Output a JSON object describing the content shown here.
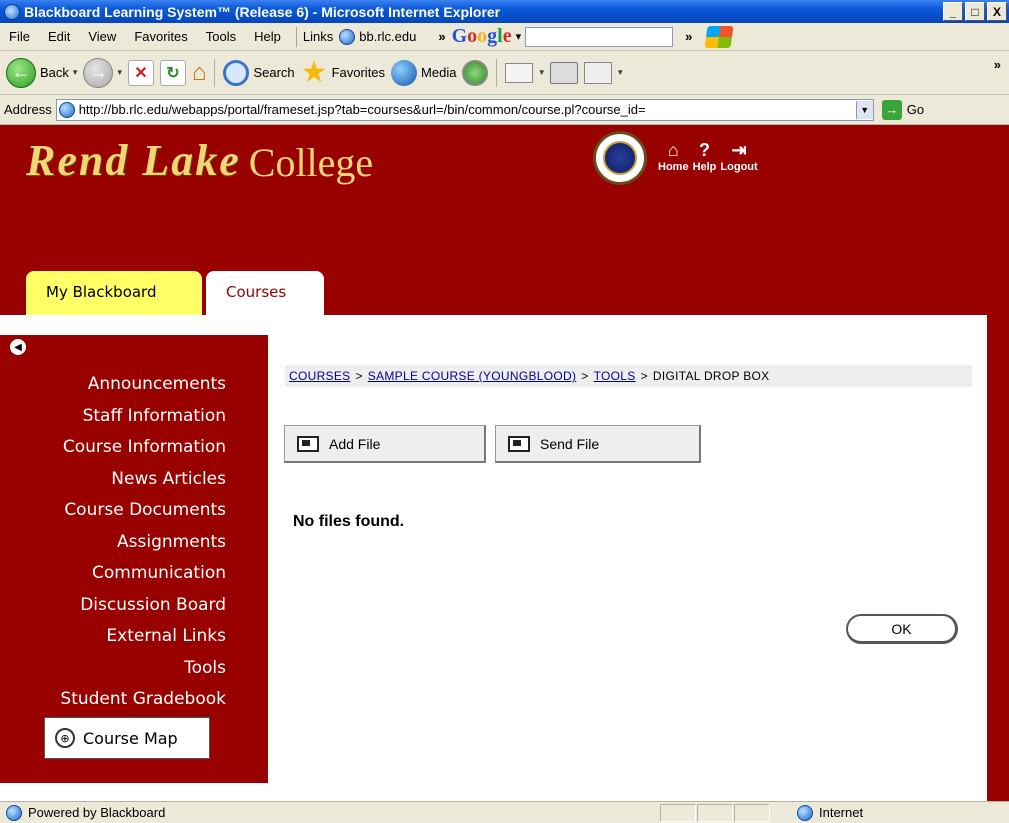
{
  "window": {
    "title": "Blackboard Learning System™ (Release 6) - Microsoft Internet Explorer",
    "min_label": "_",
    "max_label": "□",
    "close_label": "X"
  },
  "menubar": {
    "items": [
      "File",
      "Edit",
      "View",
      "Favorites",
      "Tools",
      "Help"
    ],
    "links_label": "Links",
    "link_bb": "bb.rlc.edu",
    "chevron": "»",
    "google_letters": [
      "G",
      "o",
      "o",
      "g",
      "l",
      "e"
    ],
    "google_dropdown": "▾"
  },
  "toolbar": {
    "back_label": "Back",
    "search_label": "Search",
    "favorites_label": "Favorites",
    "media_label": "Media",
    "more_label": "»"
  },
  "address": {
    "label": "Address",
    "url": "http://bb.rlc.edu/webapps/portal/frameset.jsp?tab=courses&url=/bin/common/course.pl?course_id=",
    "go_label": "Go"
  },
  "header": {
    "script_text": "Rend Lake",
    "college_text": "College",
    "nav": [
      {
        "icon": "home-icon",
        "glyph": "⌂",
        "label": "Home"
      },
      {
        "icon": "help-icon",
        "glyph": "?",
        "label": "Help"
      },
      {
        "icon": "logout-icon",
        "glyph": "⇥",
        "label": "Logout"
      }
    ]
  },
  "tabs": {
    "my_blackboard": "My Blackboard",
    "courses": "Courses"
  },
  "sidebar": {
    "items": [
      "Announcements",
      "Staff Information",
      "Course Information",
      "News Articles",
      "Course Documents",
      "Assignments",
      "Communication",
      "Discussion Board",
      "External Links",
      "Tools",
      "Student Gradebook"
    ],
    "course_map_label": "Course Map"
  },
  "breadcrumb": {
    "items": [
      {
        "label": "COURSES",
        "link": true
      },
      {
        "label": "SAMPLE COURSE (YOUNGBLOOD)",
        "link": true
      },
      {
        "label": "TOOLS",
        "link": true
      },
      {
        "label": "DIGITAL DROP BOX",
        "link": false
      }
    ],
    "separator": ">"
  },
  "actions": {
    "add_file": "Add File",
    "send_file": "Send File"
  },
  "main": {
    "empty_message": "No files found.",
    "ok_label": "OK"
  },
  "statusbar": {
    "left_text": "Powered by Blackboard",
    "zone_text": "Internet"
  },
  "colors": {
    "brand": "#990000",
    "tab_yellow": "#ffff66",
    "logo_gold": "#f2d675"
  }
}
